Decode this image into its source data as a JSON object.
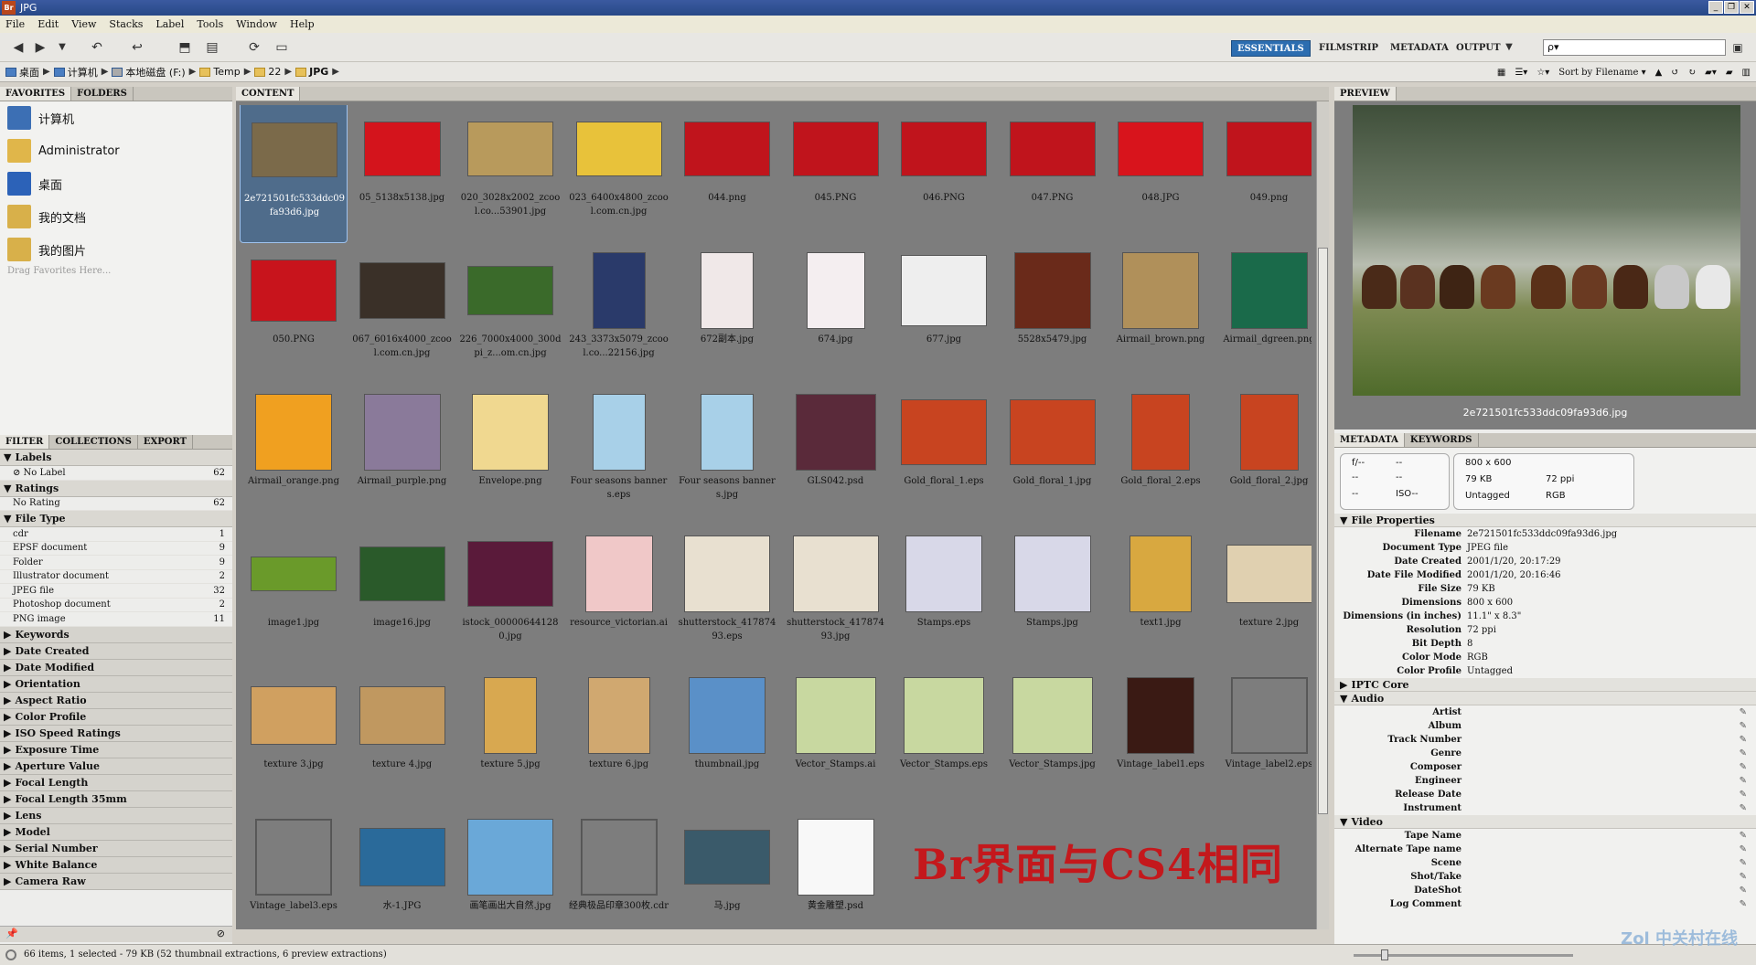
{
  "window": {
    "title": "JPG",
    "app_icon": "Br"
  },
  "menu": [
    "File",
    "Edit",
    "View",
    "Stacks",
    "Label",
    "Tools",
    "Window",
    "Help"
  ],
  "workspaces": [
    "ESSENTIALS",
    "FILMSTRIP",
    "METADATA",
    "OUTPUT"
  ],
  "search_placeholder": "ρ▾",
  "breadcrumbs": [
    "桌面",
    "计算机",
    "本地磁盘 (F:)",
    "Temp",
    "22",
    "JPG"
  ],
  "sort_label": "Sort by Filename",
  "left_tabs": [
    "FAVORITES",
    "FOLDERS"
  ],
  "favorites": [
    {
      "label": "计算机",
      "icon": "computer-icon",
      "color": "#3c6fb4"
    },
    {
      "label": "Administrator",
      "icon": "user-folder-icon",
      "color": "#e0b64a"
    },
    {
      "label": "桌面",
      "icon": "desktop-icon",
      "color": "#2c62b8"
    },
    {
      "label": "我的文档",
      "icon": "documents-icon",
      "color": "#d8b04a"
    },
    {
      "label": "我的图片",
      "icon": "pictures-icon",
      "color": "#d8b04a"
    }
  ],
  "drag_hint": "Drag Favorites Here...",
  "filter_tabs": [
    "FILTER",
    "COLLECTIONS",
    "EXPORT"
  ],
  "filter": {
    "labels_title": "Labels",
    "labels": [
      {
        "name": "No Label",
        "count": "62"
      }
    ],
    "ratings_title": "Ratings",
    "ratings": [
      {
        "name": "No Rating",
        "count": "62"
      }
    ],
    "filetype_title": "File Type",
    "filetypes": [
      {
        "name": "cdr",
        "count": "1"
      },
      {
        "name": "EPSF document",
        "count": "9"
      },
      {
        "name": "Folder",
        "count": "9"
      },
      {
        "name": "Illustrator document",
        "count": "2"
      },
      {
        "name": "JPEG file",
        "count": "32"
      },
      {
        "name": "Photoshop document",
        "count": "2"
      },
      {
        "name": "PNG image",
        "count": "11"
      }
    ],
    "collapsed": [
      "Keywords",
      "Date Created",
      "Date Modified",
      "Orientation",
      "Aspect Ratio",
      "Color Profile",
      "ISO Speed Ratings",
      "Exposure Time",
      "Aperture Value",
      "Focal Length",
      "Focal Length 35mm",
      "Lens",
      "Model",
      "Serial Number",
      "White Balance",
      "Camera Raw"
    ]
  },
  "content_tab": "CONTENT",
  "thumbnails": [
    {
      "name": "2e721501fc533ddc09fa93d6.jpg",
      "c": "#7b6a4a",
      "w": 92,
      "h": 58,
      "sel": true
    },
    {
      "name": "05_5138x5138.jpg",
      "c": "#d4141c",
      "w": 82,
      "h": 58
    },
    {
      "name": "020_3028x2002_zcool.co...53901.jpg",
      "c": "#b89a5c",
      "w": 92,
      "h": 58
    },
    {
      "name": "023_6400x4800_zcool.com.cn.jpg",
      "c": "#e8c23a",
      "w": 92,
      "h": 58
    },
    {
      "name": "044.png",
      "c": "#c0141c",
      "w": 92,
      "h": 58
    },
    {
      "name": "045.PNG",
      "c": "#c0141c",
      "w": 92,
      "h": 58
    },
    {
      "name": "046.PNG",
      "c": "#c0141c",
      "w": 92,
      "h": 58
    },
    {
      "name": "047.PNG",
      "c": "#c0141c",
      "w": 92,
      "h": 58
    },
    {
      "name": "048.JPG",
      "c": "#d8141c",
      "w": 92,
      "h": 58
    },
    {
      "name": "049.png",
      "c": "#c0141c",
      "w": 92,
      "h": 58
    },
    {
      "name": "050.PNG",
      "c": "#c8141c",
      "w": 92,
      "h": 66
    },
    {
      "name": "067_6016x4000_zcool.com.cn.jpg",
      "c": "#3a3028",
      "w": 92,
      "h": 60
    },
    {
      "name": "226_7000x4000_300dpi_z...om.cn.jpg",
      "c": "#3a6a2a",
      "w": 92,
      "h": 52
    },
    {
      "name": "243_3373x5079_zcool.co...22156.jpg",
      "c": "#2a3a6a",
      "w": 56,
      "h": 82
    },
    {
      "name": "672副本.jpg",
      "c": "#f0e8e8",
      "w": 56,
      "h": 82
    },
    {
      "name": "674.jpg",
      "c": "#f4eef0",
      "w": 62,
      "h": 82
    },
    {
      "name": "677.jpg",
      "c": "#eeeeee",
      "w": 92,
      "h": 76
    },
    {
      "name": "5528x5479.jpg",
      "c": "#6a2a1a",
      "w": 82,
      "h": 82
    },
    {
      "name": "Airmail_brown.png",
      "c": "#b0905a",
      "w": 82,
      "h": 82
    },
    {
      "name": "Airmail_dgreen.png",
      "c": "#1a6a4a",
      "w": 82,
      "h": 82
    },
    {
      "name": "Airmail_orange.png",
      "c": "#f0a020",
      "w": 82,
      "h": 82
    },
    {
      "name": "Airmail_purple.png",
      "c": "#8a7a9a",
      "w": 82,
      "h": 82
    },
    {
      "name": "Envelope.png",
      "c": "#f0d890",
      "w": 82,
      "h": 82
    },
    {
      "name": "Four seasons banners.eps",
      "c": "#a8d0e8",
      "w": 56,
      "h": 82
    },
    {
      "name": "Four seasons banners.jpg",
      "c": "#a8d0e8",
      "w": 56,
      "h": 82
    },
    {
      "name": "GLS042.psd",
      "c": "#5a2a3a",
      "w": 86,
      "h": 82
    },
    {
      "name": "Gold_floral_1.eps",
      "c": "#c84420",
      "w": 92,
      "h": 70
    },
    {
      "name": "Gold_floral_1.jpg",
      "c": "#c84420",
      "w": 92,
      "h": 70
    },
    {
      "name": "Gold_floral_2.eps",
      "c": "#c84420",
      "w": 62,
      "h": 82
    },
    {
      "name": "Gold_floral_2.jpg",
      "c": "#c84420",
      "w": 62,
      "h": 82
    },
    {
      "name": "image1.jpg",
      "c": "#6a9a2a",
      "w": 92,
      "h": 36
    },
    {
      "name": "image16.jpg",
      "c": "#2a5a2a",
      "w": 92,
      "h": 58
    },
    {
      "name": "istock_000006441280.jpg",
      "c": "#5a1a3a",
      "w": 92,
      "h": 70
    },
    {
      "name": "resource_victorian.ai",
      "c": "#f0c8c8",
      "w": 72,
      "h": 82
    },
    {
      "name": "shutterstock_41787493.eps",
      "c": "#e8e0d0",
      "w": 92,
      "h": 82
    },
    {
      "name": "shutterstock_41787493.jpg",
      "c": "#e8e0d0",
      "w": 92,
      "h": 82
    },
    {
      "name": "Stamps.eps",
      "c": "#d8d8e8",
      "w": 82,
      "h": 82
    },
    {
      "name": "Stamps.jpg",
      "c": "#d8d8e8",
      "w": 82,
      "h": 82
    },
    {
      "name": "text1.jpg",
      "c": "#d8a840",
      "w": 66,
      "h": 82
    },
    {
      "name": "texture 2.jpg",
      "c": "#e0d0b0",
      "w": 92,
      "h": 62
    },
    {
      "name": "texture 3.jpg",
      "c": "#d0a060",
      "w": 92,
      "h": 62
    },
    {
      "name": "texture 4.jpg",
      "c": "#c09860",
      "w": 92,
      "h": 62
    },
    {
      "name": "texture 5.jpg",
      "c": "#d8a850",
      "w": 56,
      "h": 82
    },
    {
      "name": "texture 6.jpg",
      "c": "#d0a870",
      "w": 66,
      "h": 82
    },
    {
      "name": "thumbnail.jpg",
      "c": "#5a90c8",
      "w": 82,
      "h": 82
    },
    {
      "name": "Vector_Stamps.ai",
      "c": "#c8d8a0",
      "w": 86,
      "h": 82
    },
    {
      "name": "Vector_Stamps.eps",
      "c": "#c8d8a0",
      "w": 86,
      "h": 82
    },
    {
      "name": "Vector_Stamps.jpg",
      "c": "#c8d8a0",
      "w": 86,
      "h": 82
    },
    {
      "name": "Vintage_label1.eps",
      "c": "#3a1a14",
      "w": 72,
      "h": 82
    },
    {
      "name": "Vintage_label2.eps",
      "c": "#7d7d7d",
      "w": 82,
      "h": 82
    },
    {
      "name": "Vintage_label3.eps",
      "c": "#7d7d7d",
      "w": 82,
      "h": 82
    },
    {
      "name": "水-1.JPG",
      "c": "#2a6a9a",
      "w": 92,
      "h": 62
    },
    {
      "name": "画笔画出大自然.jpg",
      "c": "#6aa8d8",
      "w": 92,
      "h": 82
    },
    {
      "name": "经典极品印章300枚.cdr",
      "c": "#7d7d7d",
      "w": 82,
      "h": 82
    },
    {
      "name": "马.jpg",
      "c": "#3a5a6a",
      "w": 92,
      "h": 58
    },
    {
      "name": "黄金雕塑.psd",
      "c": "#f8f8f8",
      "w": 82,
      "h": 82
    }
  ],
  "overlay_caption": "Br界面与CS4相同",
  "preview_tab": "PREVIEW",
  "preview_caption": "2e721501fc533ddc09fa93d6.jpg",
  "meta_tabs": [
    "METADATA",
    "KEYWORDS"
  ],
  "camera_info": {
    "aperture": "f/--",
    "shutter": "--",
    "a": "--",
    "b": "--",
    "c": "--",
    "iso": "ISO--"
  },
  "image_info": {
    "dims": "800 x 600",
    "size": "79 KB",
    "res": "72 ppi",
    "profile": "Untagged",
    "mode": "RGB"
  },
  "file_properties_title": "File Properties",
  "file_properties": [
    {
      "k": "Filename",
      "v": "2e721501fc533ddc09fa93d6.jpg"
    },
    {
      "k": "Document Type",
      "v": "JPEG file"
    },
    {
      "k": "Date Created",
      "v": "2001/1/20, 20:17:29"
    },
    {
      "k": "Date File Modified",
      "v": "2001/1/20, 20:16:46"
    },
    {
      "k": "File Size",
      "v": "79 KB"
    },
    {
      "k": "Dimensions",
      "v": "800 x 600"
    },
    {
      "k": "Dimensions (in inches)",
      "v": "11.1\" x 8.3\""
    },
    {
      "k": "Resolution",
      "v": "72 ppi"
    },
    {
      "k": "Bit Depth",
      "v": "8"
    },
    {
      "k": "Color Mode",
      "v": "RGB"
    },
    {
      "k": "Color Profile",
      "v": "Untagged"
    }
  ],
  "iptc_title": "IPTC Core",
  "audio_title": "Audio",
  "audio_fields": [
    "Artist",
    "Album",
    "Track Number",
    "Genre",
    "Composer",
    "Engineer",
    "Release Date",
    "Instrument"
  ],
  "video_title": "Video",
  "video_fields": [
    "Tape Name",
    "Alternate Tape name",
    "Scene",
    "Shot/Take",
    "DateShot",
    "Log Comment"
  ],
  "status": "66 items, 1 selected - 79 KB (52 thumbnail extractions, 6 preview extractions)",
  "watermark": "Zol 中关村在线"
}
